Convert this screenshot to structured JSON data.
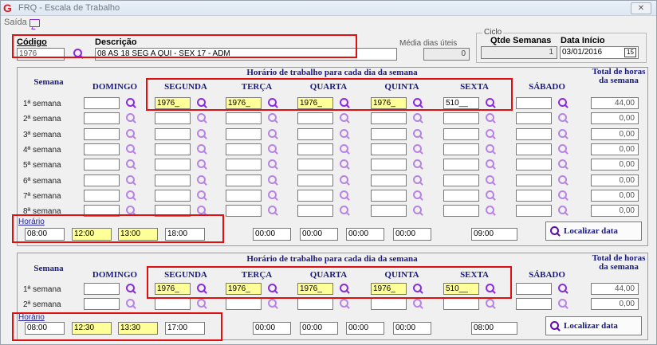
{
  "window": {
    "title": "FRQ - Escala de Trabalho",
    "close_label": "✕"
  },
  "menu": {
    "saida": "Saída"
  },
  "header": {
    "codigo_label": "Código",
    "codigo_value": "1976_",
    "descricao_label": "Descrição",
    "descricao_value": "08 AS 18 SEG A QUI - SEX 17 - ADM",
    "media_label": "Média dias úteis",
    "media_value": "0",
    "ciclo_label": "Ciclo",
    "qtde_label": "Qtde Semanas",
    "qtde_value": "1",
    "data_label": "Data Início",
    "data_value": "03/01/2016",
    "cal_label": "15"
  },
  "grid1": {
    "semana_header": "Semana",
    "group_header": "Horário de trabalho para cada dia da semana",
    "total_header": "Total de horas da semana",
    "days": [
      "DOMINGO",
      "SEGUNDA",
      "TERÇA",
      "QUARTA",
      "QUINTA",
      "SEXTA",
      "SÁBADO"
    ],
    "rows": [
      {
        "label": "1ª semana",
        "values": [
          "",
          "1976_",
          "1976_",
          "1976_",
          "1976_",
          "510__",
          ""
        ],
        "total": "44,00"
      },
      {
        "label": "2ª semana",
        "values": [
          "",
          "",
          "",
          "",
          "",
          "",
          ""
        ],
        "total": "0,00"
      },
      {
        "label": "3ª semana",
        "values": [
          "",
          "",
          "",
          "",
          "",
          "",
          ""
        ],
        "total": "0,00"
      },
      {
        "label": "4ª semana",
        "values": [
          "",
          "",
          "",
          "",
          "",
          "",
          ""
        ],
        "total": "0,00"
      },
      {
        "label": "5ª semana",
        "values": [
          "",
          "",
          "",
          "",
          "",
          "",
          ""
        ],
        "total": "0,00"
      },
      {
        "label": "6ª semana",
        "values": [
          "",
          "",
          "",
          "",
          "",
          "",
          ""
        ],
        "total": "0,00"
      },
      {
        "label": "7ª semana",
        "values": [
          "",
          "",
          "",
          "",
          "",
          "",
          ""
        ],
        "total": "0,00"
      },
      {
        "label": "8ª semana",
        "values": [
          "",
          "",
          "",
          "",
          "",
          "",
          ""
        ],
        "total": "0,00"
      }
    ],
    "horario_label": "Horário",
    "horario_values": [
      "08:00",
      "12:00",
      "13:00",
      "18:00",
      "00:00",
      "00:00",
      "00:00",
      "00:00",
      "09:00"
    ],
    "localizar_label": "Localizar data"
  },
  "grid2": {
    "semana_header": "Semana",
    "group_header": "Horário de trabalho para cada dia da semana",
    "total_header": "Total de horas da semana",
    "days": [
      "DOMINGO",
      "SEGUNDA",
      "TERÇA",
      "QUARTA",
      "QUINTA",
      "SEXTA",
      "SÁBADO"
    ],
    "rows": [
      {
        "label": "1ª semana",
        "values": [
          "",
          "1976_",
          "1976_",
          "1976_",
          "1976_",
          "510__",
          ""
        ],
        "total": "44,00"
      },
      {
        "label": "2ª semana",
        "values": [
          "",
          "",
          "",
          "",
          "",
          "",
          ""
        ],
        "total": "0,00"
      }
    ],
    "horario_label": "Horário",
    "horario_values": [
      "08:00",
      "12:30",
      "13:30",
      "17:00",
      "00:00",
      "00:00",
      "00:00",
      "00:00",
      "08:00"
    ],
    "localizar_label": "Localizar data"
  },
  "colors": {
    "highlight": "#ffff99",
    "annotation": "#e01010",
    "header_text": "#1a1a80",
    "icon": "#8a2be2"
  }
}
